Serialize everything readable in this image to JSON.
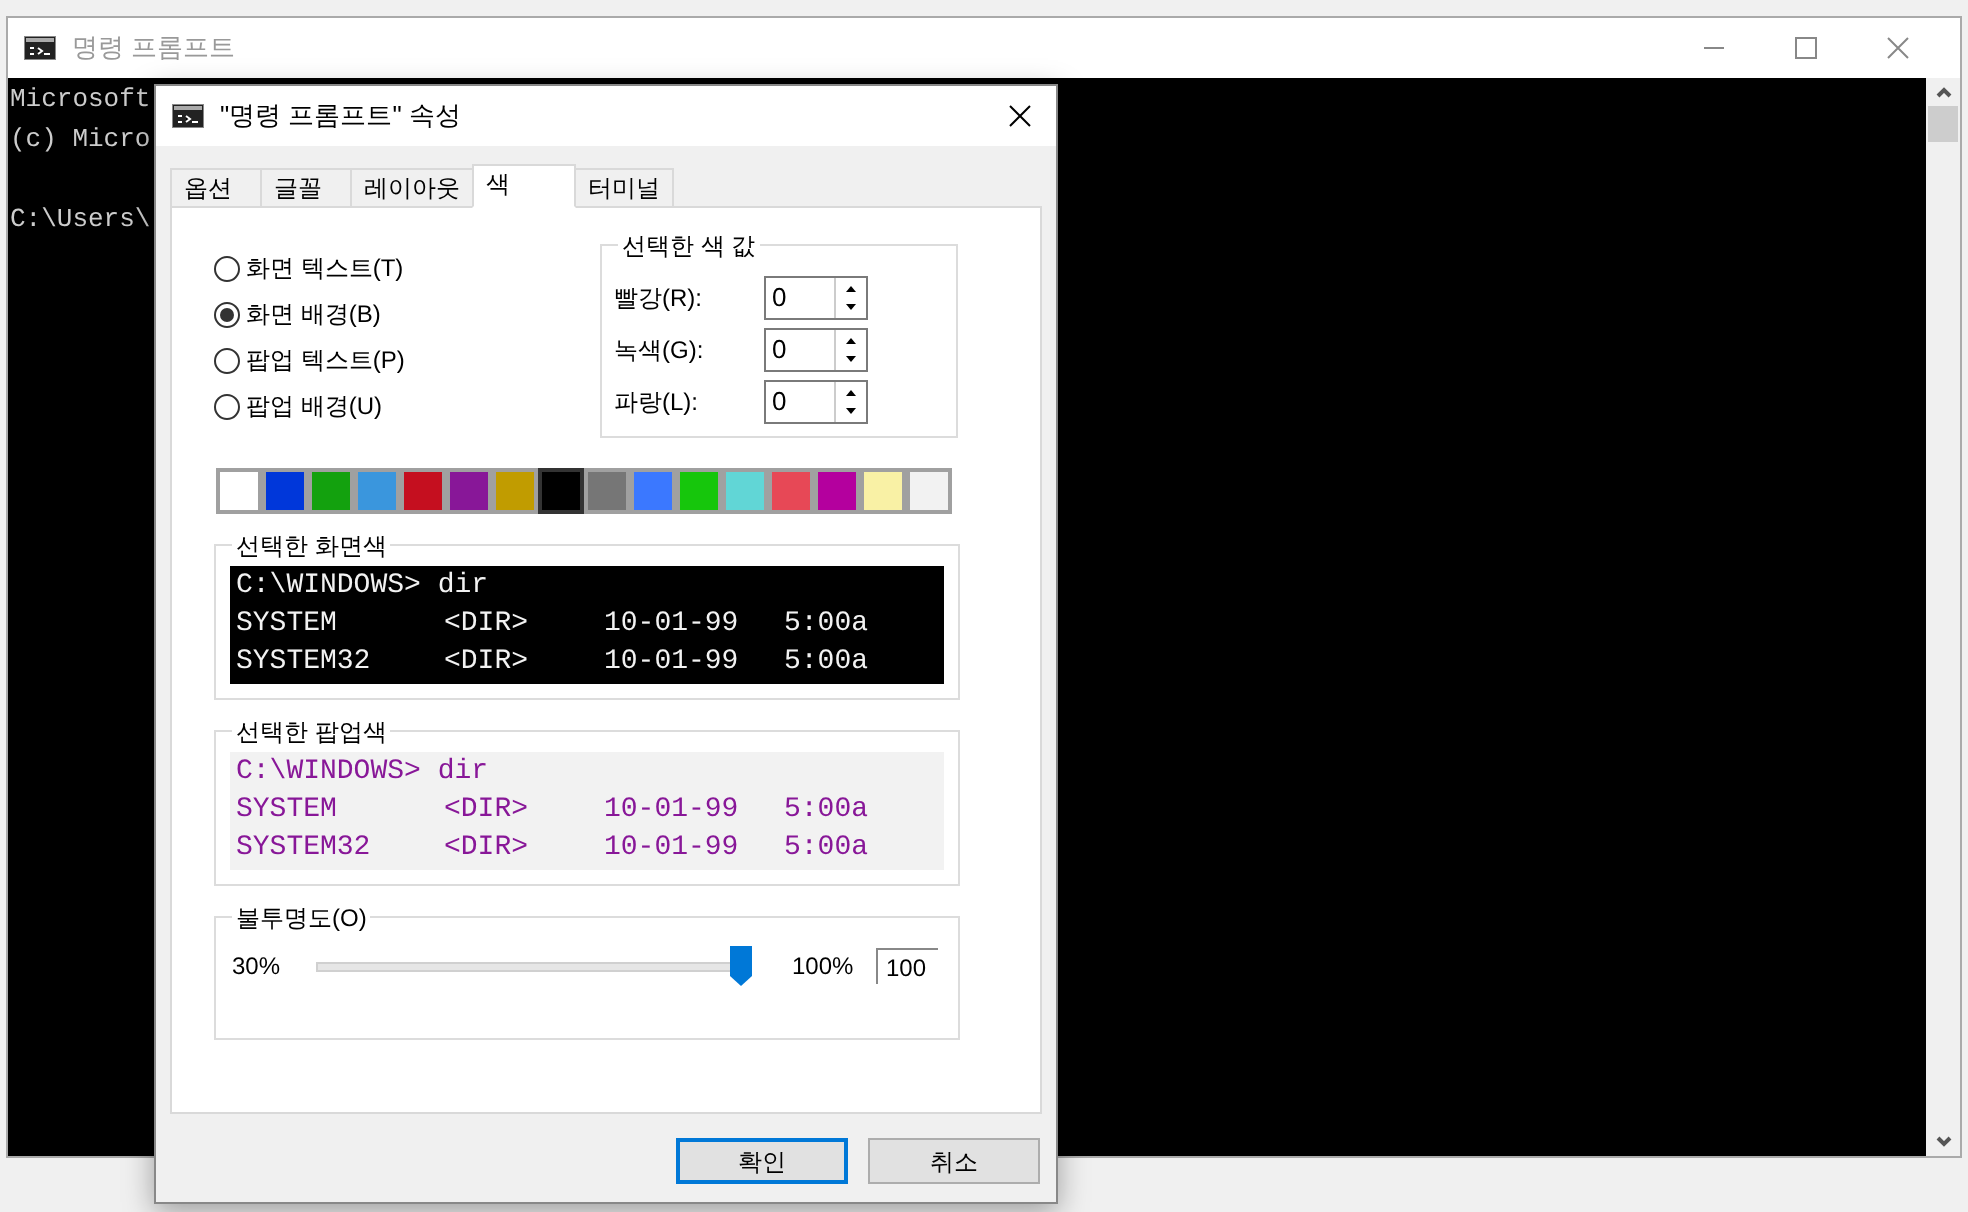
{
  "window": {
    "title": "명령 프롬프트"
  },
  "console": {
    "banner": [
      "Microsoft",
      "(c) Micro"
    ],
    "prompt": "C:\\Users\\"
  },
  "dialog": {
    "title": "\"명령 프롬프트\" 속성",
    "tabs": [
      {
        "label": "옵션",
        "selected": false
      },
      {
        "label": "글꼴",
        "selected": false
      },
      {
        "label": "레이아웃",
        "selected": false
      },
      {
        "label": "색",
        "selected": true
      },
      {
        "label": "터미널",
        "selected": false
      }
    ],
    "targets": [
      {
        "label": "화면 텍스트(T)",
        "selected": false
      },
      {
        "label": "화면 배경(B)",
        "selected": true
      },
      {
        "label": "팝업 텍스트(P)",
        "selected": false
      },
      {
        "label": "팝업 배경(U)",
        "selected": false
      }
    ],
    "color_values": {
      "title": "선택한 색 값",
      "fields": [
        {
          "label": "빨강(R):",
          "value": "0"
        },
        {
          "label": "녹색(G):",
          "value": "0"
        },
        {
          "label": "파랑(L):",
          "value": "0"
        }
      ]
    },
    "palette": [
      {
        "color": "#ffffff",
        "selected": false
      },
      {
        "color": "#0037da",
        "selected": false
      },
      {
        "color": "#13a10e",
        "selected": false
      },
      {
        "color": "#3a96dd",
        "selected": false
      },
      {
        "color": "#c50f1f",
        "selected": false
      },
      {
        "color": "#881798",
        "selected": false
      },
      {
        "color": "#c19c00",
        "selected": false
      },
      {
        "color": "#000000",
        "selected": true
      },
      {
        "color": "#767676",
        "selected": false
      },
      {
        "color": "#3b78ff",
        "selected": false
      },
      {
        "color": "#16c60c",
        "selected": false
      },
      {
        "color": "#61d6d6",
        "selected": false
      },
      {
        "color": "#e74856",
        "selected": false
      },
      {
        "color": "#b4009e",
        "selected": false
      },
      {
        "color": "#f9f1a5",
        "selected": false
      },
      {
        "color": "#f2f2f2",
        "selected": false
      }
    ],
    "previews": [
      {
        "title": "선택한 화면색",
        "color": "#000000",
        "lines": [
          {
            "color": "#f2f2f2",
            "cells": [
              "C:\\WINDOWS> dir"
            ]
          },
          {
            "color": "#f2f2f2",
            "cells": [
              "SYSTEM",
              "<DIR>",
              "10-01-99",
              "5:00a"
            ]
          },
          {
            "color": "#f2f2f2",
            "cells": [
              "SYSTEM32",
              "<DIR>",
              "10-01-99",
              "5:00a"
            ]
          }
        ]
      },
      {
        "title": "선택한 팝업색",
        "color": "#f2f2f2",
        "lines": [
          {
            "color": "#881798",
            "cells": [
              "C:\\WINDOWS> dir"
            ]
          },
          {
            "color": "#881798",
            "cells": [
              "SYSTEM",
              "<DIR>",
              "10-01-99",
              "5:00a"
            ]
          },
          {
            "color": "#881798",
            "cells": [
              "SYSTEM32",
              "<DIR>",
              "10-01-99",
              "5:00a"
            ]
          }
        ]
      }
    ],
    "opacity": {
      "title": "불투명도(O)",
      "min_label": "30%",
      "max_label": "100%",
      "level": 1,
      "value": "100"
    },
    "buttons": [
      {
        "label": "확인",
        "selected": true
      },
      {
        "label": "취소",
        "selected": false
      }
    ]
  }
}
